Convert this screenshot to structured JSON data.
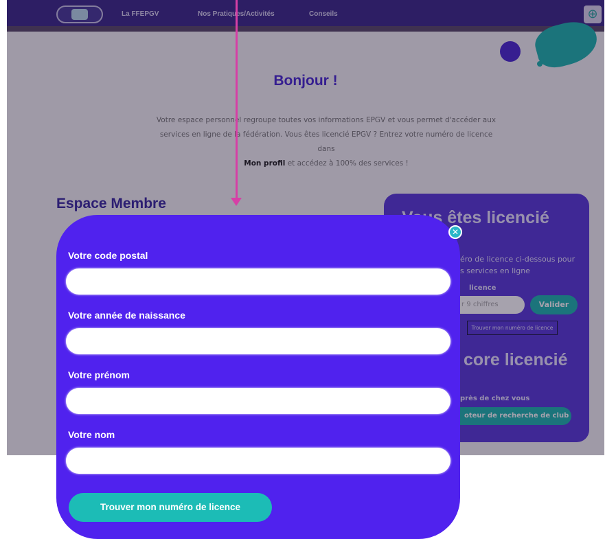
{
  "nav": {
    "links": [
      "La FFEPGV",
      "Nos Pratiques/Activités",
      "Conseils"
    ],
    "plus_symbol": "⊕"
  },
  "hero": {
    "title": "Bonjour !",
    "intro_line1": "Votre espace personnel regroupe toutes vos informations EPGV et vous permet d'accéder aux",
    "intro_line2": "services en ligne de la fédération. Vous êtes licencié EPGV ? Entrez votre numéro de licence dans",
    "intro_bold": "Mon profil",
    "intro_line3_rest": " et accédez à 100% des services !"
  },
  "espace_membre": {
    "title": "Espace Membre"
  },
  "side_card": {
    "title1": "Vous êtes licencié",
    "text1_line1": "éro de licence ci-dessous pour",
    "text1_line2": "s services en ligne",
    "licence_label": "licence",
    "licence_placeholder": "r 9 chiffres",
    "valider_label": "Valider",
    "find_button_label": "Trouver mon numéro de licence",
    "title2": "core licencié",
    "text2": "près de chez vous",
    "moteur_label": "oteur de recherche de club"
  },
  "modal": {
    "close_symbol": "✕",
    "fields": [
      {
        "label": "Votre code postal",
        "value": ""
      },
      {
        "label": "Votre année de naissance",
        "value": ""
      },
      {
        "label": "Votre prénom",
        "value": ""
      },
      {
        "label": "Votre nom",
        "value": ""
      }
    ],
    "submit_label": "Trouver mon numéro de licence"
  },
  "colors": {
    "modal_bg": "#5022ee",
    "accent_teal": "#1cbcb6",
    "arrow": "#d63fa6",
    "nav_bg": "#3d2a8a"
  }
}
